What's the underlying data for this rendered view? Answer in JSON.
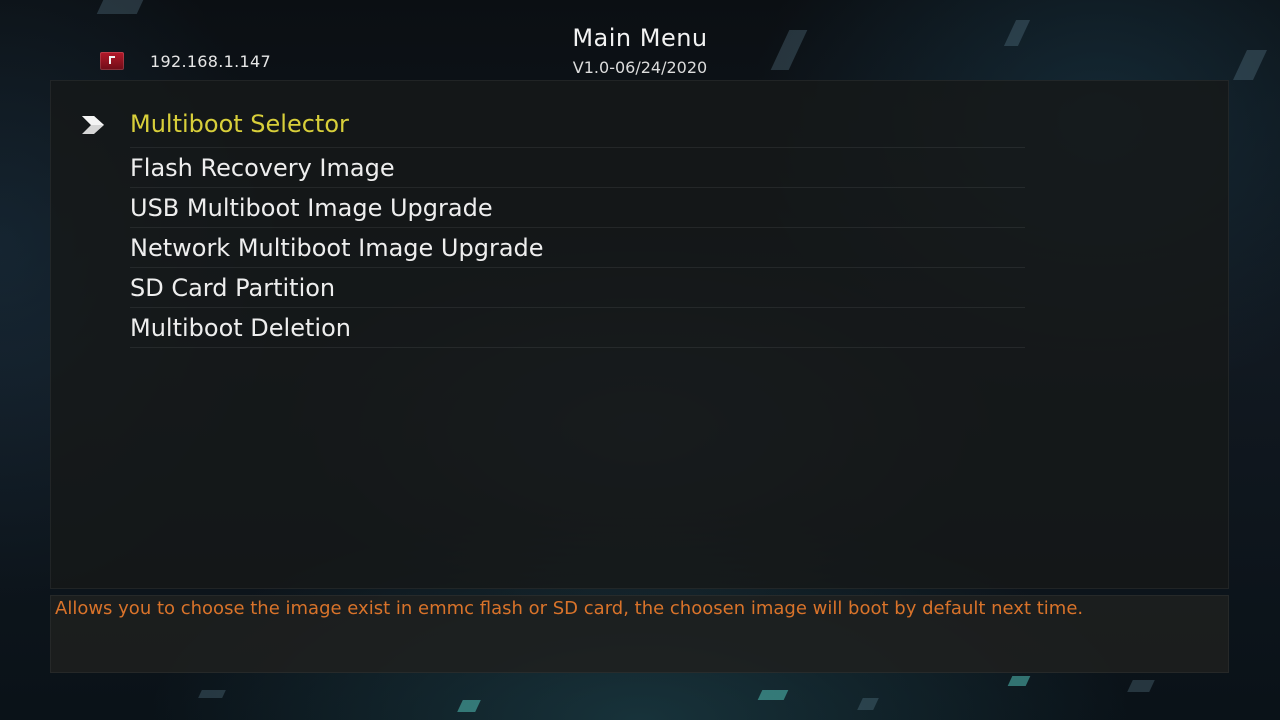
{
  "header": {
    "title": "Main Menu",
    "version": "V1.0-06/24/2020",
    "ip_address": "192.168.1.147",
    "ip_icon": "network-status-icon"
  },
  "menu": {
    "selected_index": 0,
    "items": [
      {
        "label": "Multiboot Selector"
      },
      {
        "label": "Flash Recovery Image"
      },
      {
        "label": "USB Multiboot Image Upgrade"
      },
      {
        "label": "Network Multiboot Image Upgrade"
      },
      {
        "label": "SD Card Partition"
      },
      {
        "label": "Multiboot Deletion"
      }
    ]
  },
  "help": {
    "text": "Allows you to choose the image exist in emmc flash or SD card, the choosen image will boot by default next time."
  },
  "colors": {
    "selected_text": "#d8cf3a",
    "help_text": "#d9732a",
    "menu_text": "#eeeeee"
  }
}
